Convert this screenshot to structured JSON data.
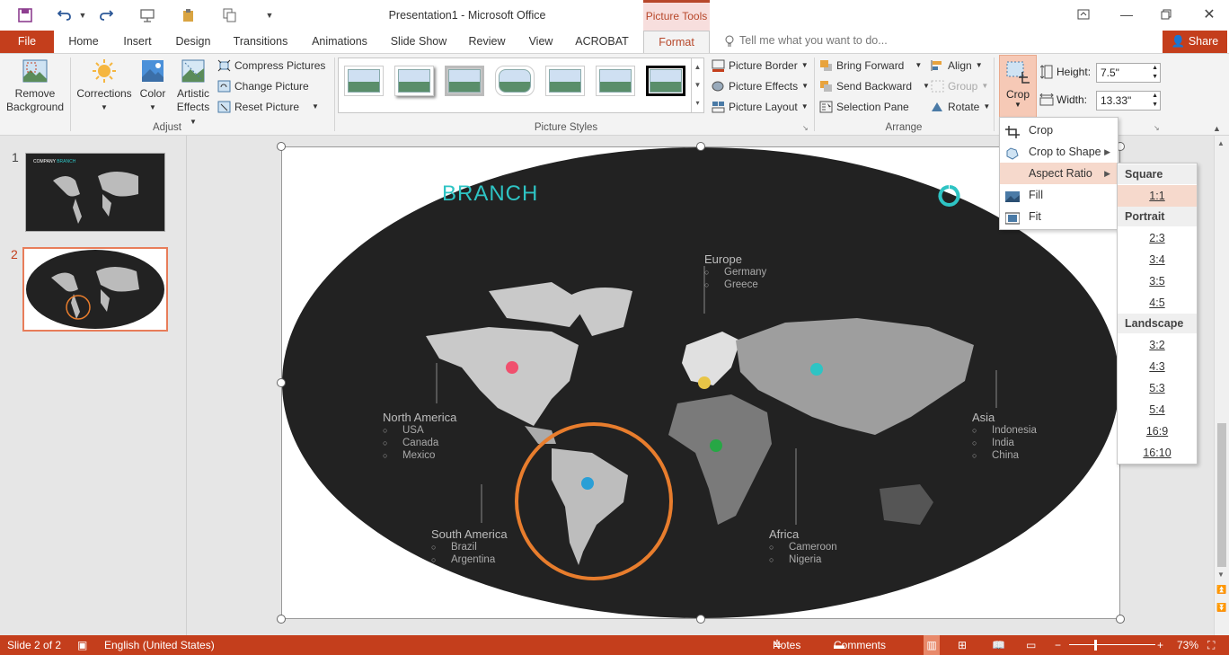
{
  "app": {
    "title": "Presentation1 - Microsoft Office",
    "context_tab": "Picture Tools"
  },
  "tabs": {
    "file": "File",
    "home": "Home",
    "insert": "Insert",
    "design": "Design",
    "transitions": "Transitions",
    "animations": "Animations",
    "slideshow": "Slide Show",
    "review": "Review",
    "view": "View",
    "acrobat": "ACROBAT",
    "format": "Format"
  },
  "tell_me": "Tell me what you want to do...",
  "share": "Share",
  "ribbon": {
    "remove_bg_1": "Remove",
    "remove_bg_2": "Background",
    "corrections": "Corrections",
    "color": "Color",
    "artistic_1": "Artistic",
    "artistic_2": "Effects",
    "compress": "Compress Pictures",
    "change": "Change Picture",
    "reset": "Reset Picture",
    "adjust_label": "Adjust",
    "styles_label": "Picture Styles",
    "border": "Picture Border",
    "effects": "Picture Effects",
    "layout": "Picture Layout",
    "bring_forward": "Bring Forward",
    "send_backward": "Send Backward",
    "selection_pane": "Selection Pane",
    "align": "Align",
    "group": "Group",
    "rotate": "Rotate",
    "arrange_label": "Arrange",
    "crop": "Crop",
    "height_label": "Height:",
    "height_value": "7.5\"",
    "width_label": "Width:",
    "width_value": "13.33\""
  },
  "slides": {
    "n1": "1",
    "n2": "2"
  },
  "slide": {
    "brand": "BRANCH",
    "regions": [
      {
        "name": "Europe",
        "items": [
          "Germany",
          "Greece"
        ]
      },
      {
        "name": "North America",
        "items": [
          "USA",
          "Canada",
          "Mexico"
        ]
      },
      {
        "name": "Asia",
        "items": [
          "Indonesia",
          "India",
          "China"
        ]
      },
      {
        "name": "South America",
        "items": [
          "Brazil",
          "Argentina"
        ]
      },
      {
        "name": "Africa",
        "items": [
          "Cameroon",
          "Nigeria"
        ]
      }
    ],
    "colors": {
      "bg": "#222222",
      "teal": "#2ec4c4",
      "orange": "#e87d2d",
      "pink": "#f0506e",
      "yellow": "#e8c547",
      "green": "#27a745",
      "blue": "#2a9fd6"
    }
  },
  "crop_menu": {
    "crop": "Crop",
    "crop_to_shape": "Crop to Shape",
    "aspect_ratio": "Aspect Ratio",
    "fill": "Fill",
    "fit": "Fit"
  },
  "aspect": {
    "square": "Square",
    "r1_1": "1:1",
    "portrait": "Portrait",
    "r2_3": "2:3",
    "r3_4": "3:4",
    "r3_5": "3:5",
    "r4_5": "4:5",
    "landscape": "Landscape",
    "r3_2": "3:2",
    "r4_3": "4:3",
    "r5_3": "5:3",
    "r5_4": "5:4",
    "r16_9": "16:9",
    "r16_10": "16:10"
  },
  "status": {
    "slide": "Slide 2 of 2",
    "language": "English (United States)",
    "notes": "Notes",
    "comments": "Comments",
    "zoom": "73%"
  }
}
